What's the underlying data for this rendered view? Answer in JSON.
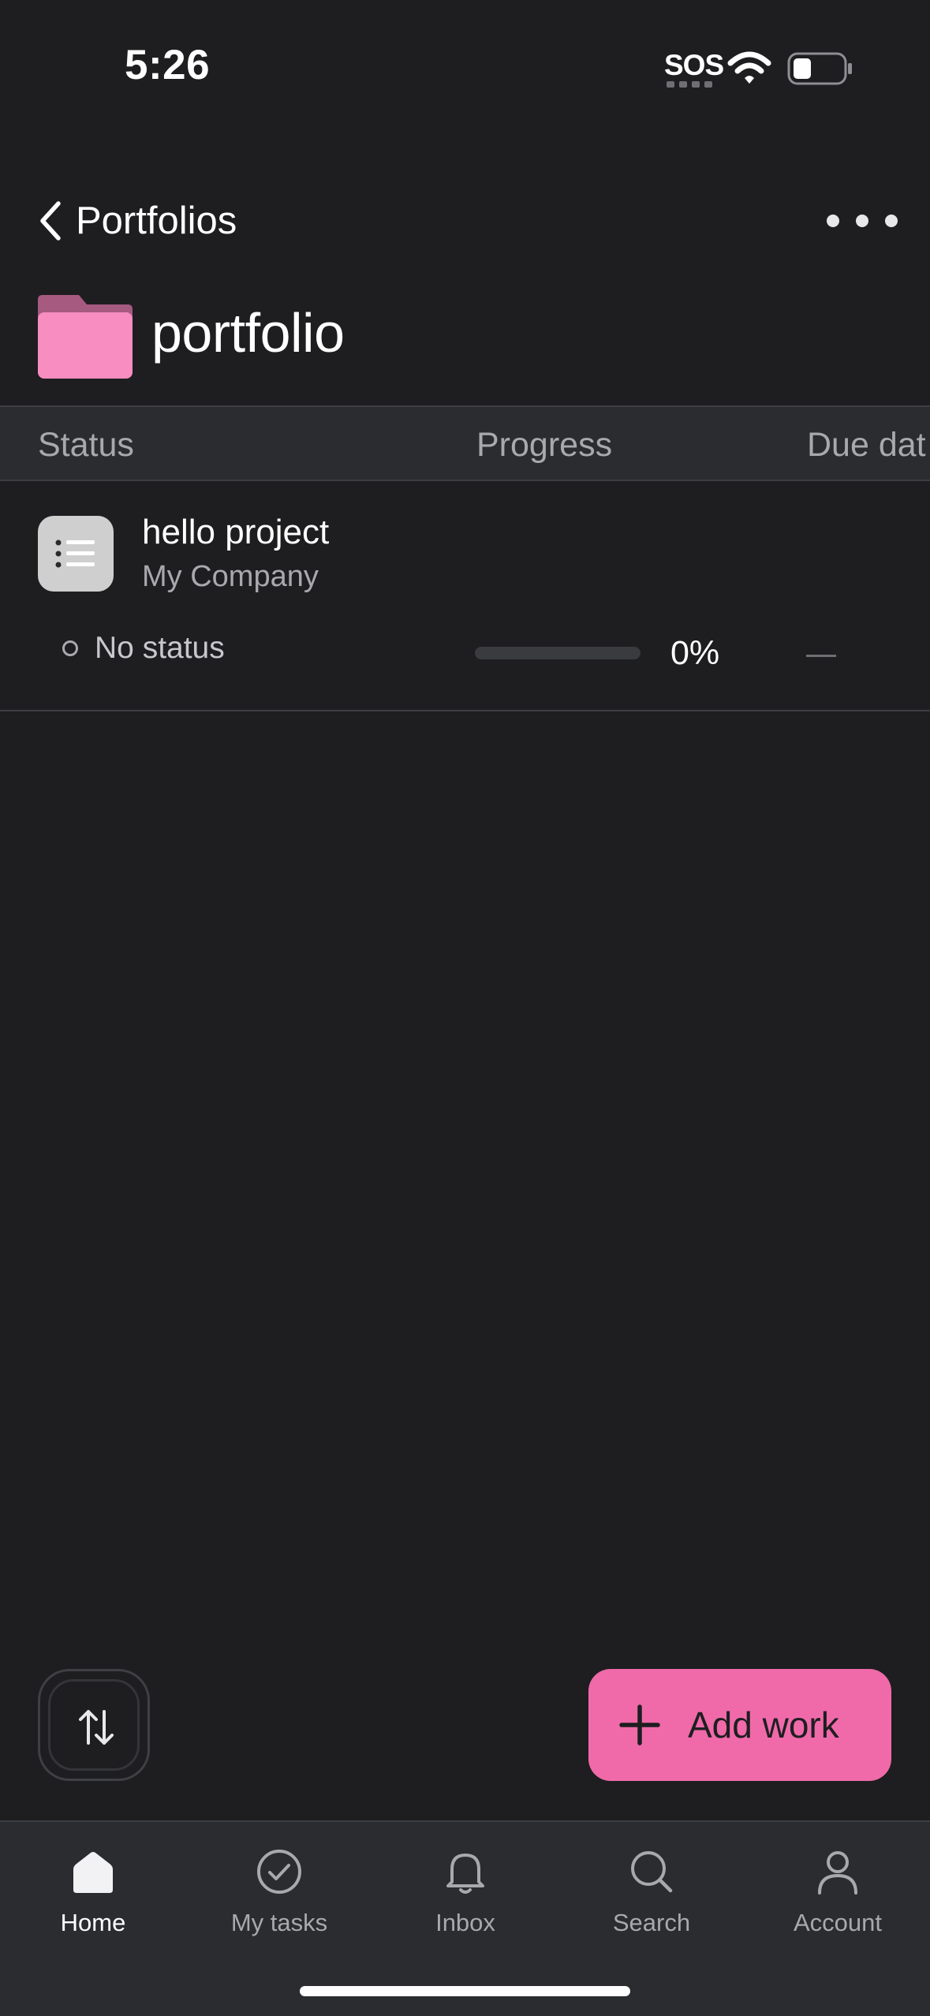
{
  "status_bar": {
    "time": "5:26",
    "carrier": "SOS"
  },
  "header": {
    "back_label": "Portfolios",
    "title": "portfolio"
  },
  "columns": {
    "status": "Status",
    "progress": "Progress",
    "due": "Due dat"
  },
  "project": {
    "name": "hello project",
    "team": "My Company",
    "status": "No status",
    "progress_value": 0,
    "progress_label": "0%"
  },
  "actions": {
    "add_work": "Add work"
  },
  "tabs": [
    {
      "label": "Home",
      "icon": "home-icon",
      "active": true
    },
    {
      "label": "My tasks",
      "icon": "check-circle-icon",
      "active": false
    },
    {
      "label": "Inbox",
      "icon": "bell-icon",
      "active": false
    },
    {
      "label": "Search",
      "icon": "search-icon",
      "active": false
    },
    {
      "label": "Account",
      "icon": "person-icon",
      "active": false
    }
  ],
  "colors": {
    "background": "#1e1e20",
    "accent": "#f06aaa",
    "header_band": "#2b2c30"
  }
}
